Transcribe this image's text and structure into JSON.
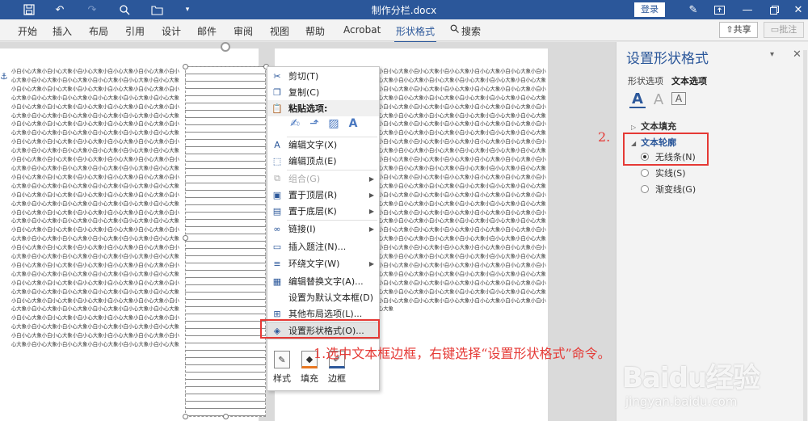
{
  "window": {
    "title": "制作分栏.docx",
    "login_label": "登录"
  },
  "ribbon": {
    "tabs": [
      {
        "label": "开始"
      },
      {
        "label": "插入"
      },
      {
        "label": "布局"
      },
      {
        "label": "引用"
      },
      {
        "label": "设计"
      },
      {
        "label": "邮件"
      },
      {
        "label": "审阅"
      },
      {
        "label": "视图"
      },
      {
        "label": "帮助"
      },
      {
        "label": "Acrobat"
      },
      {
        "label": "形状格式"
      },
      {
        "label": "搜索"
      }
    ],
    "share_label": "共享",
    "comment_label": "批注"
  },
  "document": {
    "col1_text": "小白小心大象小白小心大象小白小心大象小白小心大象小白小心大象小白小心大象小白小心大象小白小心大象小白小心大象小白小心大象小白小心大象小白小心大象小白小心大象小白小心大象小白小心大象小白小心大象小白小心大象小白小心大象小白小心大象小白小心大象小白小心大象小白小心大象小白小心大象小白小心大象小白小心大象小白小心大象小白小心大象小白小心大象小白小心大象小白小心大象小白小心大象小白小心大象小白小心大象小白小心大象小白小心大象小白小心大象小白小心大象小白小心大象小白小心大象小白小心大象小白小心大象小白小心大象小白小心大象小白小心大象小白小心大象小白小心大象小白小心大象小白小心大象小白小心大象小白小心大象小白小心大象小白小心大象小白小心大象小白小心大象小白小心大象小白小心大象小白小心大象小白小心大象小白小心大象小白小心大象小白小心大象小白小心大象小白小心大象小白小心大象小白小心大象小白小心大象小白小心大象小白小心大象小白小心大象小白小心大象小白小心大象小白小心大象小白小心大象小白小心大象小白小心大象小白小心大象小白小心大象小白小心大象小白小心大象小白小心大象小白小心大象小白小心大象小白小心大象小白小心大象小白小心大象小白小心大象小白小心大象小白小心大象小白小心大象小白小心大象小白小心大象小白小心大象小白小心大象小白小心大象小白小心大象小白小心大象小白小心大象小白小心大象小白小心大象小白小心大象小白小心大象小白小心大象小白小心大象小白小心大象小白小心大象小白小心大象小白小心大象小白小心大象小白小心大象小白小心大象小白小心大象小白小心大象小白小心大象小白小心大象小白小心大象小白小心大象小白小心大象小白小心大象小白小心大象小白小心大象小白小心大象小白小心大象小白小心大象小白小心大象小白小心大象小白小心大象小白小心大象小白小心大象小白小心大象小白小心大象小白小心大象小白小心大象小白小心大象小白小心大象小白小心大象小白小心大象小白小心大象小白小心大象小白小心大象小白小心大象小白小心大象小白小心大象小白小心大象小白小心大象小白小心大象小白小心大象小白小心大象小白小心大象小白小心大象小白小心大象小白小心大象小白小心大象小白小心大象小白小心大象小白小心大象小白小心大象小白小心大象小白小心大象小白小心大象小白小心大象小白小心大象小白小心大象小白小心大象小白小心大象小白小心大象小白小心大象小白小心大象小白小心大象小白小心大象小白小心大象小白小心大象小白小心大象小白小心大象小白小心大象小白小心大象小白小心大象",
    "col2_text": "小白小心大象小白小心大象小白小心大象小白小心大象小白小心大象小白小心大象小白小心大象小白小心大象小白小心大象小白小心大象小白小心大象小白小心大象小白小心大象小白小心大象小白小心大象小白小心大象小白小心大象小白小心大象小白小心大象小白小心大象小白小心大象小白小心大象小白小心大象小白小心大象小白小心大象小白小心大象小白小心大象小白小心大象小白小心大象小白小心大象小白小心大象小白小心大象小白小心大象小白小心大象小白小心大象小白小心大象小白小心大象小白小心大象小白小心大象小白小心大象小白小心大象小白小心大象小白小心大象小白小心大象小白小心大象小白小心大象小白小心大象小白小心大象小白小心大象小白小心大象小白小心大象小白小心大象小白小心大象小白小心大象小白小心大象小白小心大象小白小心大象小白小心大象小白小心大象小白小心大象小白小心大象小白小心大象小白小心大象小白小心大象小白小心大象小白小心大象小白小心大象小白小心大象小白小心大象小白小心大象小白小心大象小白小心大象小白小心大象小白小心大象小白小心大象小白小心大象小白小心大象小白小心大象小白小心大象小白小心大象小白小心大象小白小心大象小白小心大象小白小心大象小白小心大象小白小心大象小白小心大象小白小心大象小白小心大象小白小心大象小白小心大象小白小心大象小白小心大象小白小心大象小白小心大象小白小心大象小白小心大象小白小心大象小白小心大象小白小心大象小白小心大象小白小心大象小白小心大象小白小心大象小白小心大象小白小心大象小白小心大象小白小心大象小白小心大象小白小心大象小白小心大象小白小心大象小白小心大象小白小心大象小白小心大象小白小心大象小白小心大象小白小心大象小白小心大象小白小心大象小白小心大象小白小心大象小白小心大象小白小心大象小白小心大象小白小心大象小白小心大象小白小心大象小白小心大象小白小心大象小白小心大象小白小心大象小白小心大象小白小心大象小白小心大象小白小心大象小白小心大象小白小心大象小白小心大象小白小心大象小白小心大象小白小心大象小白小心大象小白小心大象小白小心大象小白小心大象小白小心大象小白小心大象小白小心大象"
  },
  "context_menu": {
    "cut": "剪切(T)",
    "copy": "复制(C)",
    "paste_options": "粘贴选项:",
    "edit_text": "编辑文字(X)",
    "edit_points": "编辑顶点(E)",
    "group": "组合(G)",
    "bring_to_front": "置于顶层(R)",
    "send_to_back": "置于底层(K)",
    "link": "链接(I)",
    "insert_caption": "插入题注(N)...",
    "wrap_text": "环绕文字(W)",
    "edit_alt_text": "编辑替换文字(A)...",
    "set_default_textbox": "设置为默认文本框(D)",
    "more_layout": "其他布局选项(L)...",
    "format_shape": "设置形状格式(O)...",
    "mini_style": "样式",
    "mini_fill": "填充",
    "mini_outline": "边框"
  },
  "pane": {
    "title": "设置形状格式",
    "tab_shape": "形状选项",
    "tab_text": "文本选项",
    "text_fill": "文本填充",
    "text_outline": "文本轮廓",
    "opt_none": "无线条(N)",
    "opt_solid": "实线(S)",
    "opt_gradient": "渐变线(G)"
  },
  "annotations": {
    "step_number": "2.",
    "instruction": "1.选中文本框边框，右键选择“设置形状格式”命令。"
  },
  "watermark": {
    "brand": "Baidu经验",
    "url": "jingyan.baidu.com"
  },
  "colors": {
    "word_blue": "#2b579a",
    "annotation_red": "#e53935"
  }
}
